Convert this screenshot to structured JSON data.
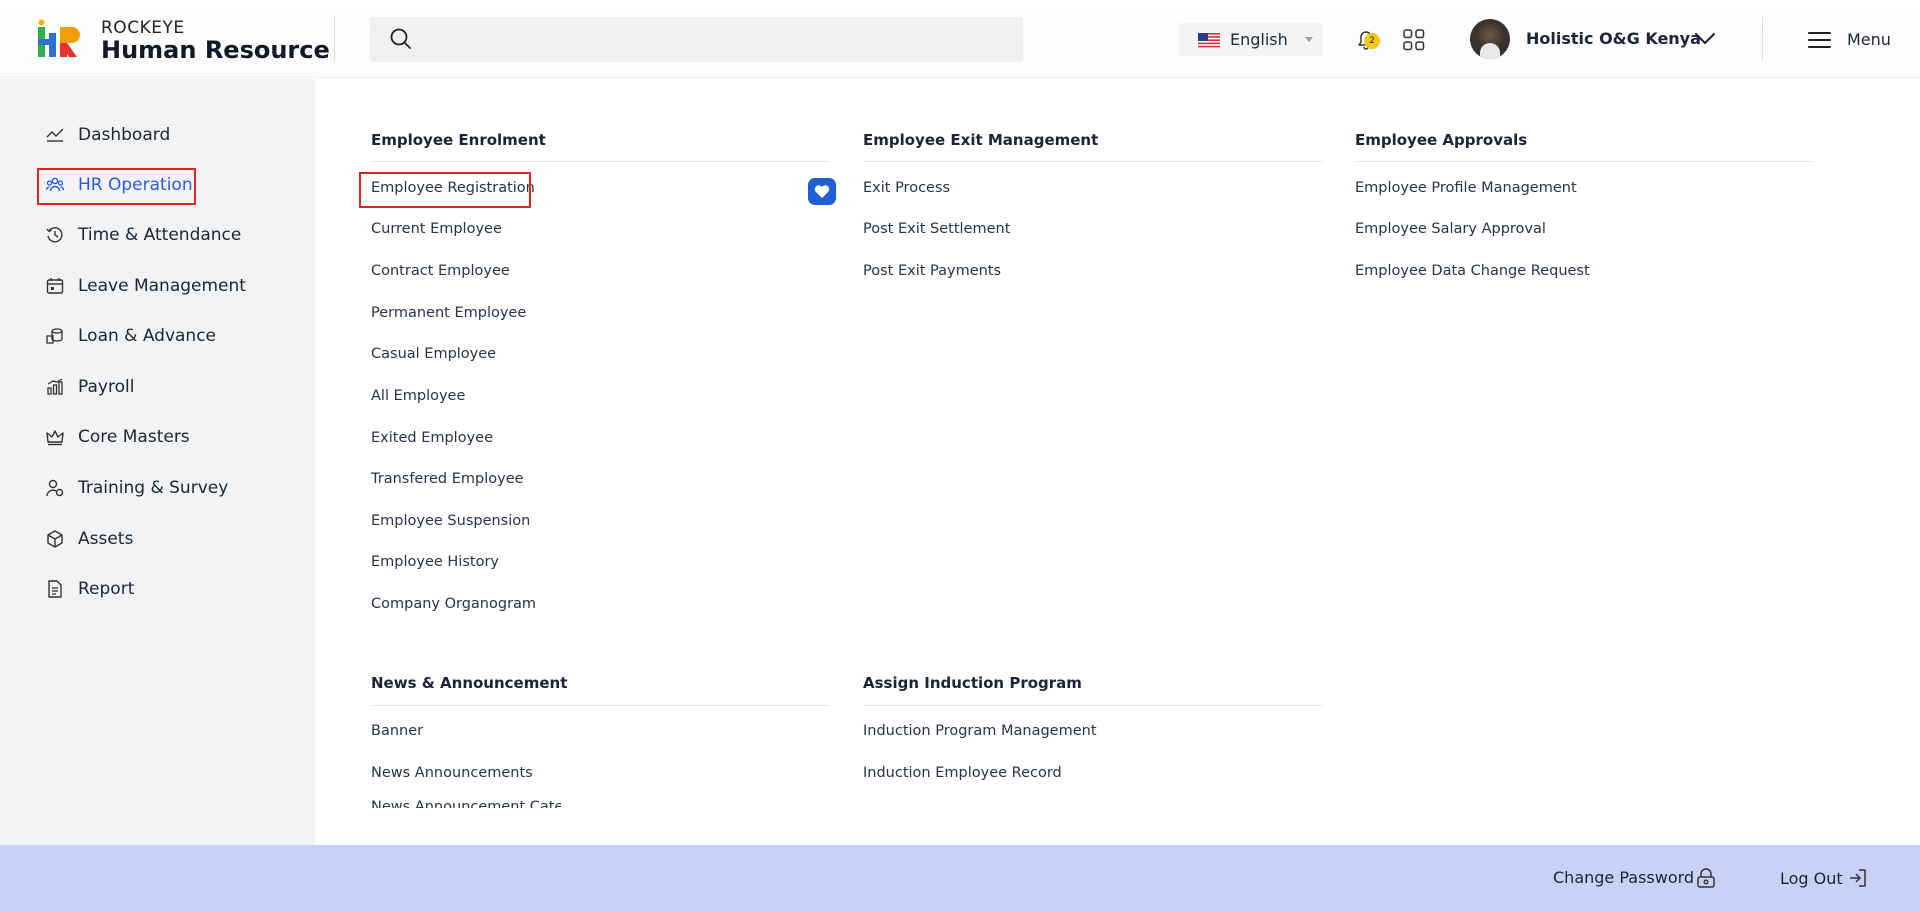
{
  "header": {
    "brand_top": "ROCKEYE",
    "brand_main": "Human Resource",
    "search_placeholder": "",
    "language": "English",
    "notification_count": "2",
    "user_name": "Holistic O&G Kenya",
    "menu_label": "Menu"
  },
  "sidebar": {
    "items": [
      {
        "label": "Dashboard",
        "icon": "chart-line-icon"
      },
      {
        "label": "HR Operation",
        "icon": "people-group-icon",
        "active": true
      },
      {
        "label": "Time & Attendance",
        "icon": "clock-history-icon"
      },
      {
        "label": "Leave Management",
        "icon": "calendar-icon"
      },
      {
        "label": "Loan & Advance",
        "icon": "coins-icon"
      },
      {
        "label": "Payroll",
        "icon": "payroll-chart-icon"
      },
      {
        "label": "Core Masters",
        "icon": "crown-icon"
      },
      {
        "label": "Training & Survey",
        "icon": "training-icon"
      },
      {
        "label": "Assets",
        "icon": "cube-icon"
      },
      {
        "label": "Report",
        "icon": "document-icon"
      }
    ]
  },
  "menu": {
    "enrolment": {
      "title": "Employee Enrolment",
      "links": [
        "Employee Registration",
        "Current Employee",
        "Contract Employee",
        "Permanent Employee",
        "Casual Employee",
        "All Employee",
        "Exited Employee",
        "Transfered Employee",
        "Employee Suspension",
        "Employee History",
        "Company Organogram"
      ]
    },
    "exit": {
      "title": "Employee Exit Management",
      "links": [
        "Exit Process",
        "Post Exit Settlement",
        "Post Exit Payments"
      ]
    },
    "approvals": {
      "title": "Employee Approvals",
      "links": [
        "Employee Profile Management",
        "Employee Salary Approval",
        "Employee Data Change Request"
      ]
    },
    "news": {
      "title": "News & Announcement",
      "links": [
        "Banner",
        "News Announcements",
        "News Announcement Category"
      ]
    },
    "induction": {
      "title": "Assign Induction Program",
      "links": [
        "Induction Program Management",
        "Induction Employee Record"
      ]
    }
  },
  "footer": {
    "change_password": "Change Password",
    "logout": "Log Out"
  },
  "colors": {
    "accent": "#2a5bd7",
    "highlight_border": "#e02424",
    "footer_bg": "#c9d1f7",
    "sidebar_bg": "#f2f3f5"
  }
}
